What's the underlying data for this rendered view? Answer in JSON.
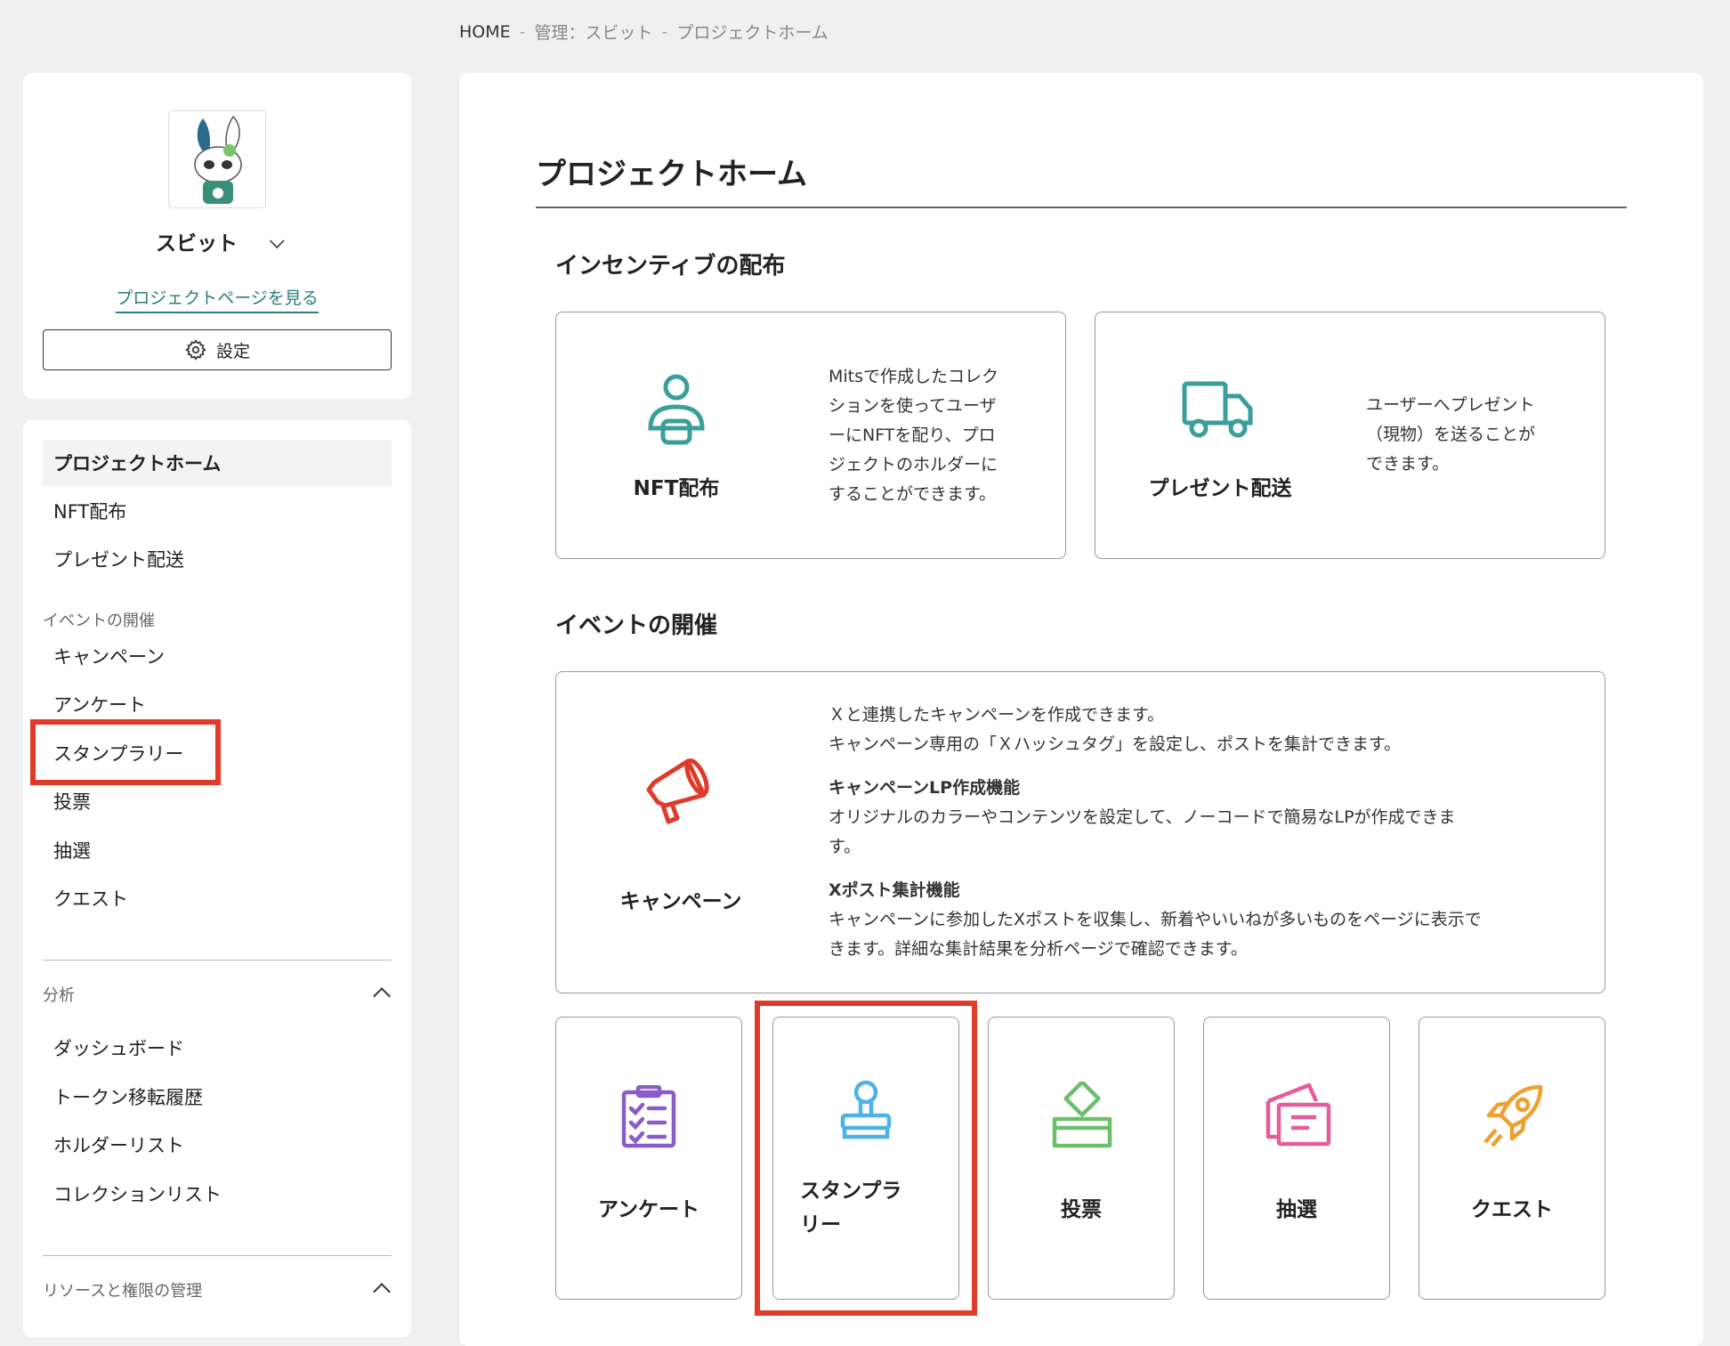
{
  "breadcrumb": {
    "home": "HOME",
    "sep": "-",
    "admin": "管理：スビット",
    "current": "プロジェクトホーム"
  },
  "profile": {
    "name": "スビット",
    "link": "プロジェクトページを見る",
    "settings": "設定"
  },
  "nav": {
    "home": "プロジェクトホーム",
    "nft": "NFT配布",
    "present": "プレゼント配送",
    "events_section": "イベントの開催",
    "campaign": "キャンペーン",
    "survey": "アンケート",
    "stamp": "スタンプラリー",
    "vote": "投票",
    "lottery": "抽選",
    "quest": "クエスト",
    "analytics_section": "分析",
    "dashboard": "ダッシュボード",
    "token_history": "トークン移転履歴",
    "holders": "ホルダーリスト",
    "collections": "コレクションリスト",
    "resources_section": "リソースと権限の管理"
  },
  "main": {
    "title": "プロジェクトホーム",
    "incentive_title": "インセンティブの配布",
    "nft_card": {
      "label": "NFT配布",
      "desc": [
        "Mitsで作成したコレク",
        "ションを使ってユーザ",
        "ーにNFTを配り、プロ",
        "ジェクトのホルダーに",
        "することができます。"
      ]
    },
    "present_card": {
      "label": "プレゼント配送",
      "desc": [
        "ユーザーへプレゼント",
        "（現物）を送ることが",
        "できます。"
      ]
    },
    "event_title": "イベントの開催",
    "campaign_card": {
      "label": "キャンペーン",
      "line1": "Ｘと連携したキャンペーンを作成できます。",
      "line2": "キャンペーン専用の「Ｘハッシュタグ」を設定し、ポストを集計できます。",
      "lp_title": "キャンペーンLP作成機能",
      "lp_desc1": "オリジナルのカラーやコンテンツを設定して、ノーコードで簡易なLPが作成できま",
      "lp_desc2": "す。",
      "post_title": "Xポスト集計機能",
      "post_desc1": "キャンペーンに参加したXポストを収集し、新着やいいねが多いものをページに表示で",
      "post_desc2": "きます。詳細な集計結果を分析ページで確認できます。"
    },
    "small_cards": {
      "survey": "アンケート",
      "stamp_line1": "スタンプラ",
      "stamp_line2": "リー",
      "vote": "投票",
      "lottery": "抽選",
      "quest": "クエスト"
    }
  },
  "colors": {
    "teal": "#3a9e9a",
    "red": "#e03a2a",
    "purple": "#8a5cc7",
    "blue": "#4db3e6",
    "green": "#6cc06c",
    "pink": "#e65b9c",
    "orange": "#f0a030"
  }
}
